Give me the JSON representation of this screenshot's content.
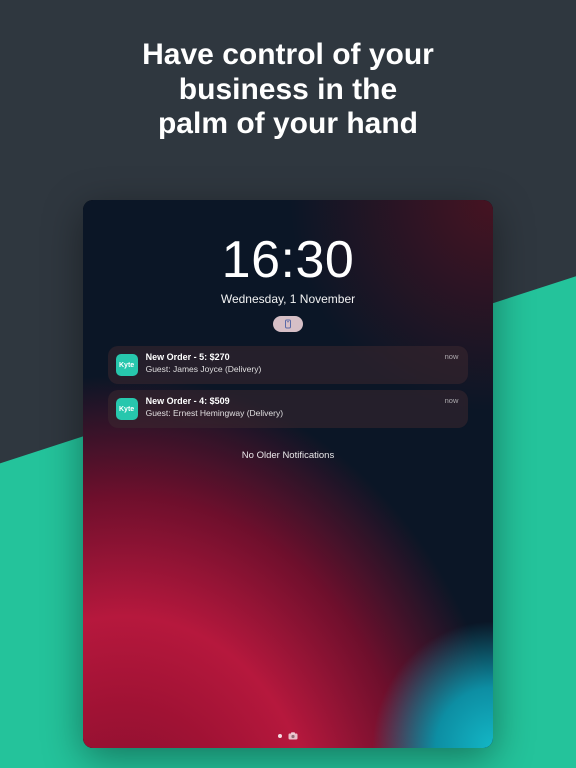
{
  "marketing": {
    "headline_l1": "Have control of your",
    "headline_l2": "business in the",
    "headline_l3": "palm of your hand"
  },
  "colors": {
    "accent": "#24c39b",
    "dark": "#2f373f",
    "app_icon": "#27c7ad"
  },
  "lockscreen": {
    "clock": "16:30",
    "date": "Wednesday, 1 November",
    "dnd_icon": "focus-icon",
    "no_older_label": "No Older Notifications"
  },
  "app": {
    "icon_label": "Kyte"
  },
  "notifications": [
    {
      "title": "New Order - 5: $270",
      "subtitle": "Guest: James Joyce (Delivery)",
      "time": "now"
    },
    {
      "title": "New Order - 4: $509",
      "subtitle": "Guest: Ernest Hemingway (Delivery)",
      "time": "now"
    }
  ]
}
